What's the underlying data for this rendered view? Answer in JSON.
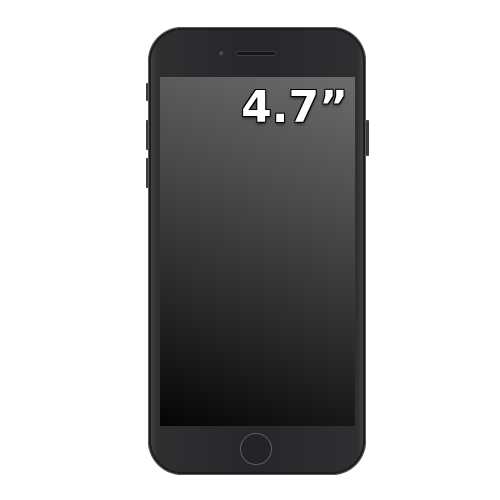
{
  "device": {
    "screen_size_label": "4.7”",
    "colors": {
      "body": "#26272a",
      "screen_top": "#6b6b6b",
      "screen_bottom": "#050505",
      "label": "#ffffff"
    },
    "icons": [
      "front-camera-icon",
      "earpiece-icon",
      "home-button-icon"
    ]
  }
}
